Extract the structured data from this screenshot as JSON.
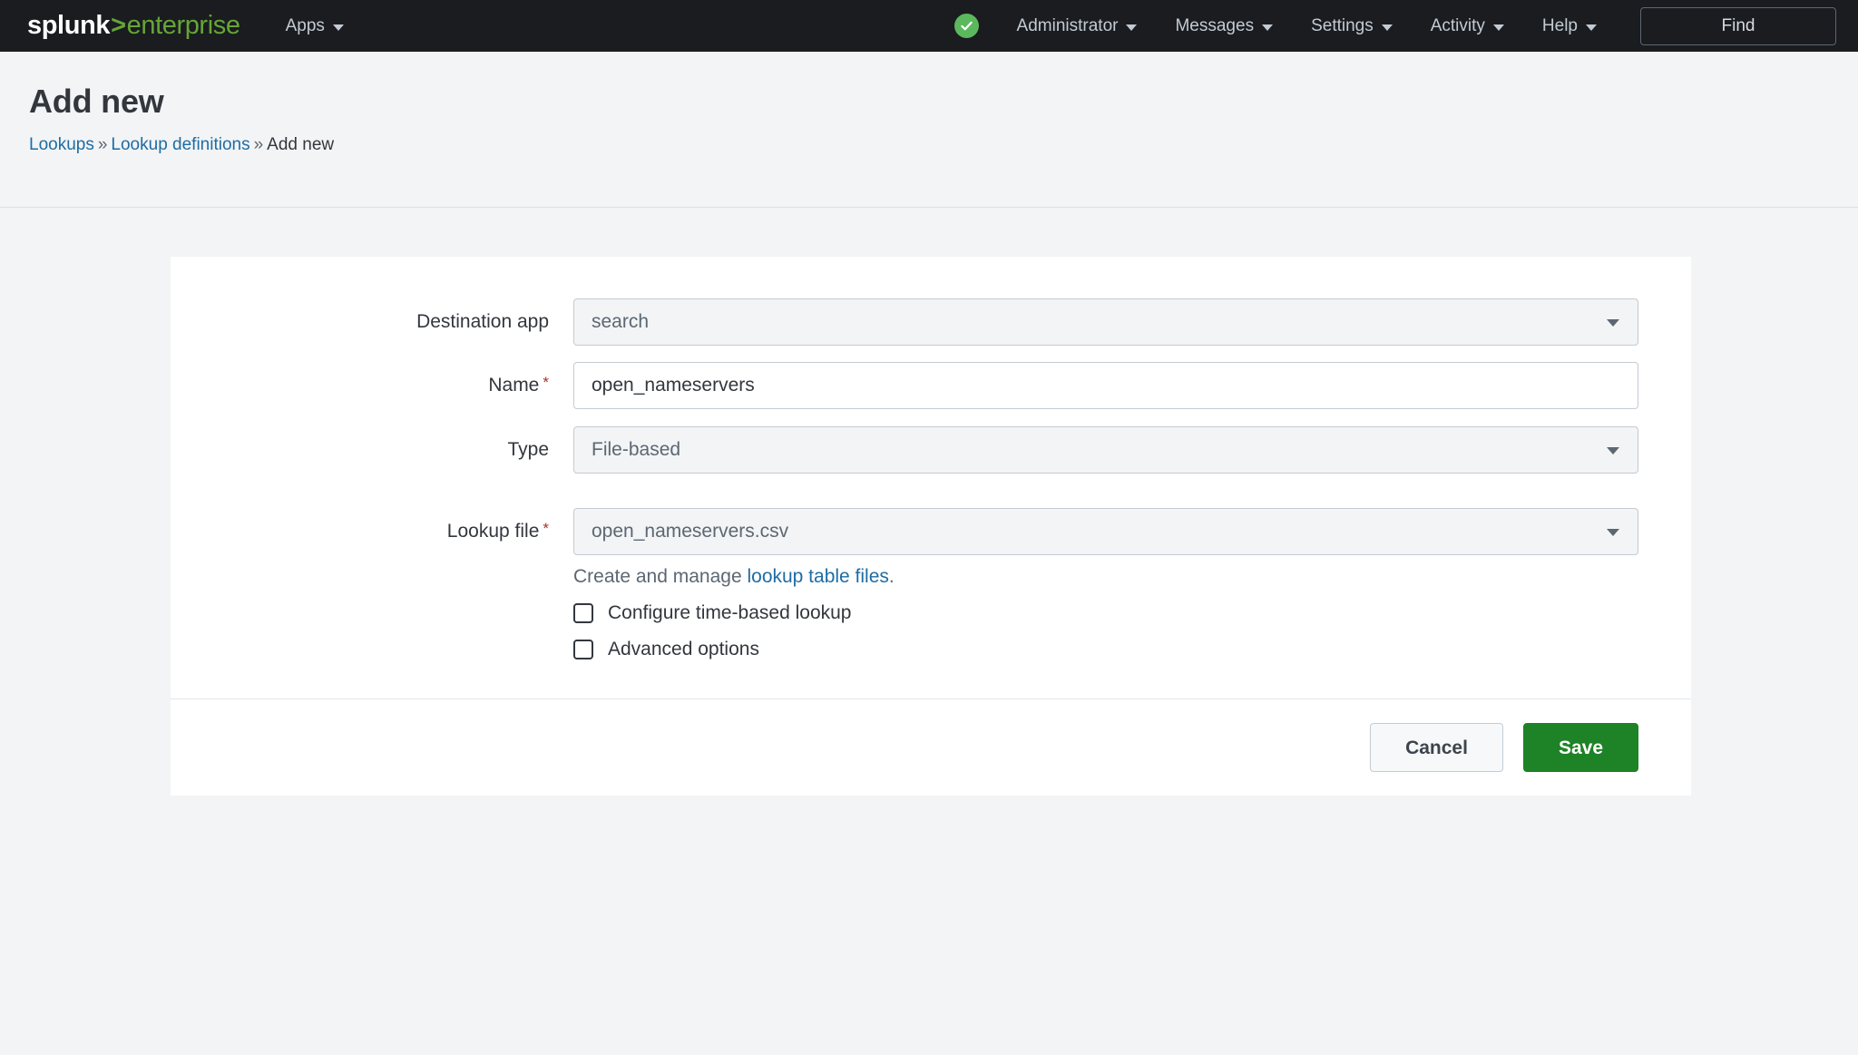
{
  "navbar": {
    "brand": {
      "name": "splunk",
      "sep": ">",
      "edition": "enterprise"
    },
    "apps_label": "Apps",
    "health_icon": "green-check-icon",
    "items": [
      {
        "label": "Administrator"
      },
      {
        "label": "Messages"
      },
      {
        "label": "Settings"
      },
      {
        "label": "Activity"
      },
      {
        "label": "Help"
      }
    ],
    "find_label": "Find"
  },
  "header": {
    "title": "Add new",
    "breadcrumb": {
      "first": "Lookups",
      "second": "Lookup definitions",
      "current": "Add new",
      "separator": "»"
    }
  },
  "form": {
    "destination_app": {
      "label": "Destination app",
      "value": "search",
      "required": false
    },
    "name": {
      "label": "Name",
      "value": "open_nameservers",
      "placeholder": "",
      "required": true,
      "required_mark": "*"
    },
    "type": {
      "label": "Type",
      "value": "File-based",
      "required": false
    },
    "lookup_file": {
      "label": "Lookup file",
      "value": "open_nameservers.csv",
      "required": true,
      "required_mark": "*"
    },
    "help": {
      "prefix": "Create and manage ",
      "link": "lookup table files",
      "suffix": "."
    },
    "checkboxes": [
      {
        "label": "Configure time-based lookup",
        "checked": false
      },
      {
        "label": "Advanced options",
        "checked": false
      }
    ]
  },
  "footer": {
    "cancel_label": "Cancel",
    "save_label": "Save"
  },
  "colors": {
    "brand_green": "#65a637",
    "save_green": "#1e8226",
    "link_blue": "#1e6ca4",
    "required_red": "#a4352c",
    "navbar_bg": "#1a1c20",
    "page_bg": "#f2f4f5"
  }
}
